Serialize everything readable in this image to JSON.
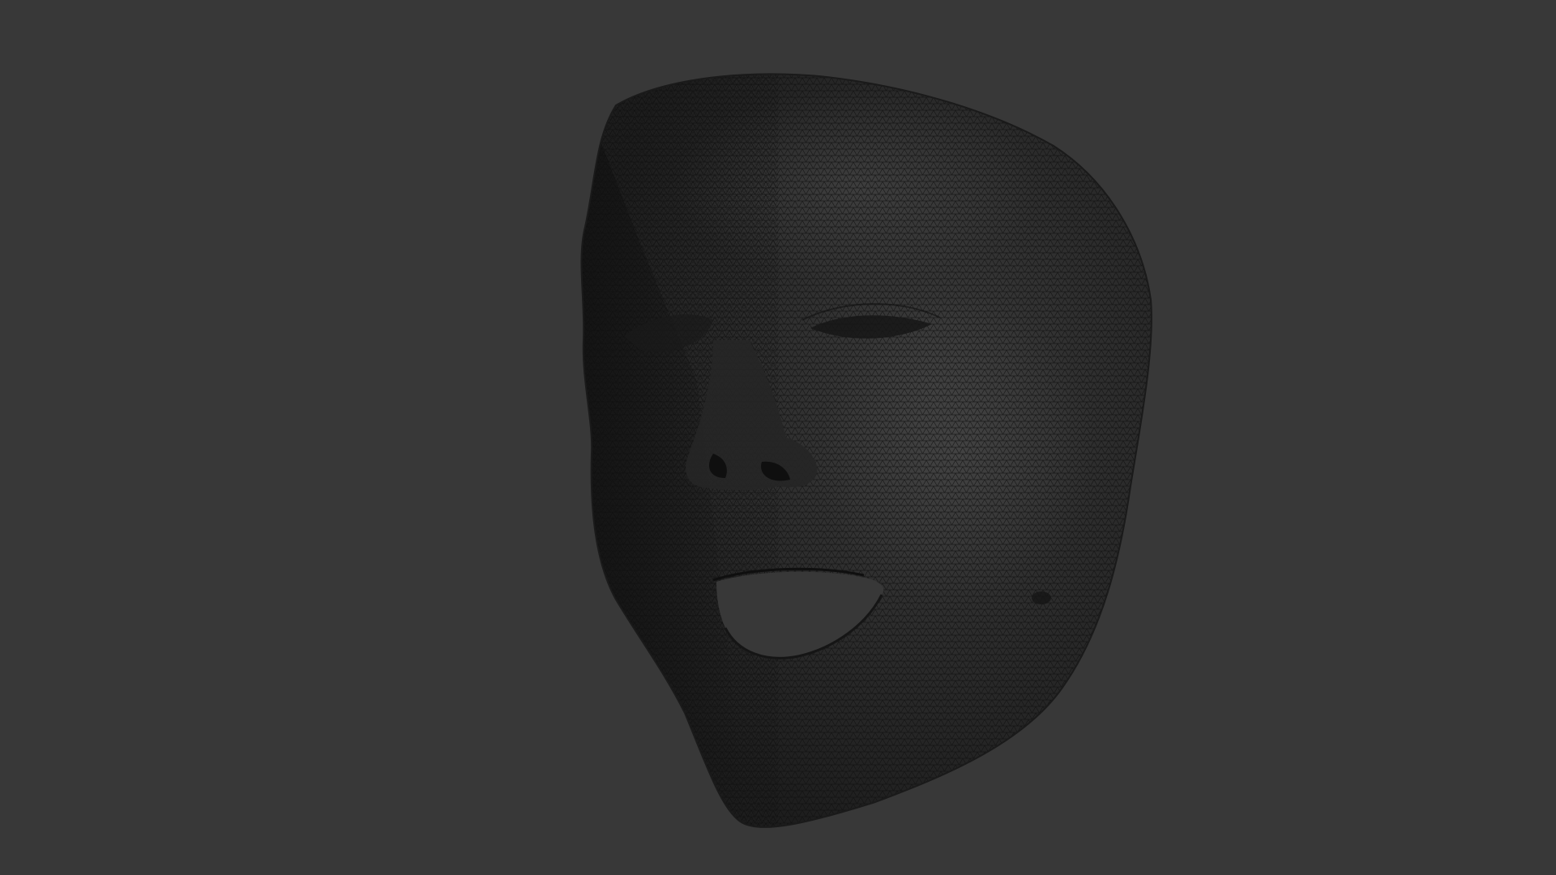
{
  "viewport": {
    "background_color": "#383838",
    "subject": "face-mesh",
    "render_mode": "shaded-wireframe"
  },
  "colors": {
    "mesh_base": "#262626",
    "mesh_highlight": "#4a4a4a",
    "mesh_shadow": "#141414",
    "wire": "#0e0e0e"
  }
}
